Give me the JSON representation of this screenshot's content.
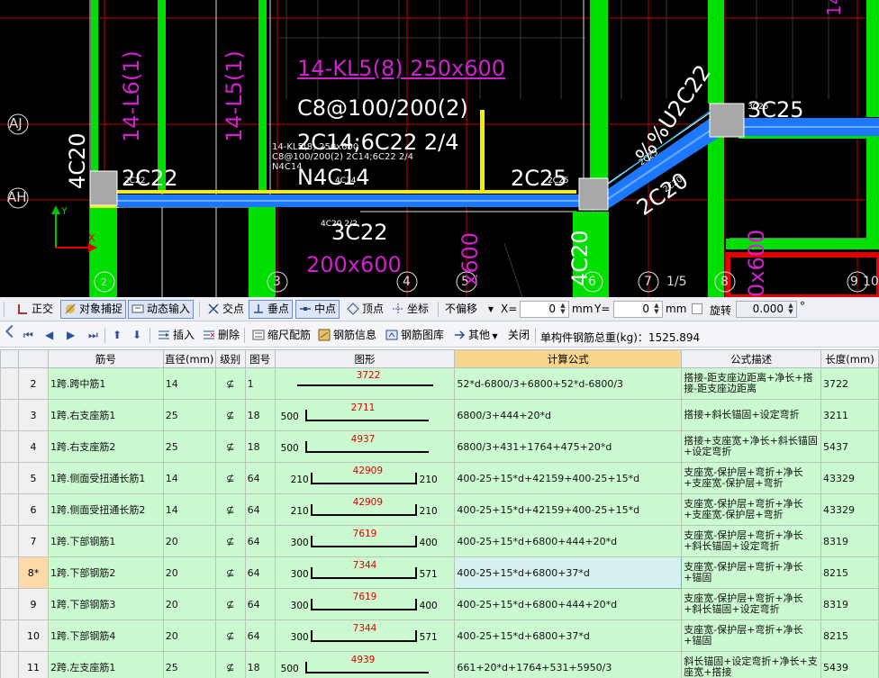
{
  "cad": {
    "axis_labels": {
      "aj": "AJ",
      "ah": "AH",
      "y": "Y",
      "x": "X"
    },
    "grid_numbers": [
      "2",
      "3",
      "4",
      "5",
      "6",
      "7",
      "1/5",
      "8",
      "9",
      "10"
    ],
    "beam_kl5": "14-KL5(8) 250x600",
    "beam_l6": "14-L6(1)",
    "beam_l5": "14-L5(1)",
    "stirrup": "C8@100/200(2)",
    "top_bars": "2C14;6C22 2/4",
    "side_bars": "N4C14",
    "bot_bars": "3C22",
    "section": "200x600",
    "small_lines": [
      "14-KL5(8) 250x600",
      "C8@100/200(2) 2C14;6C22 2/4",
      "N4C14"
    ],
    "col_4c20_left": "4C20",
    "col_4c20_mid": "4C20",
    "bar_2c22": "2C22",
    "bar_2c22_small": "2C22",
    "bar_2c25": "2C25",
    "bar_2c25_small": "2C25",
    "bar_3c25": "3C25",
    "bar_3c25_small": "3C25",
    "bar_2c20": "2C20",
    "bar_2c20_small": "2C20",
    "bar_4c14_small": "4C14",
    "bar_4c20_small": "4C20 2/2",
    "beam_diag": "%%U2C22",
    "beam_diag_small": "2C25",
    "purple_vert1": "x600",
    "purple_vert2": "0x600",
    "top_right_mark": "14"
  },
  "toolbar1": {
    "zhengjiao": "正交",
    "snap": "对象捕捉",
    "dyn_input": "动态输入",
    "intersect": "交点",
    "perp": "垂点",
    "mid": "中点",
    "vertex": "顶点",
    "coord": "坐标",
    "offset_mode": "不偏移",
    "x_label": "X=",
    "x_value": "0",
    "y_label": "Y=",
    "y_value": "0",
    "unit1": "mm",
    "unit2": "mm",
    "rotate_label": "旋转",
    "rotate_value": "0.000",
    "degree": "°"
  },
  "toolbar2": {
    "insert": "插入",
    "delete": "删除",
    "scale_rebar": "缩尺配筋",
    "rebar_info": "钢筋信息",
    "rebar_lib": "钢筋图库",
    "other": "其他",
    "close": "关闭",
    "total_weight": "单构件钢筋总重(kg)：1525.894"
  },
  "table": {
    "headers": [
      "筋号",
      "直径(mm)",
      "级别",
      "图号",
      "图形",
      "计算公式",
      "公式描述",
      "长度(mm)"
    ],
    "rows": [
      {
        "idx": "2",
        "name": "1跨.跨中筋1",
        "dia": "14",
        "grade": "⊈",
        "fig": "1",
        "shape": {
          "type": "line",
          "mid": "3722"
        },
        "formula": "52*d-6800/3+6800+52*d-6800/3",
        "desc": "搭接-距支座边距离+净长+搭接-距支座边距离",
        "len": "3722"
      },
      {
        "idx": "3",
        "name": "1跨.右支座筋1",
        "dia": "25",
        "grade": "⊈",
        "fig": "18",
        "shape": {
          "type": "hook-left",
          "left": "500",
          "mid": "2711"
        },
        "formula": "6800/3+444+20*d",
        "desc": "搭接+斜长锚固+设定弯折",
        "len": "3211"
      },
      {
        "idx": "4",
        "name": "1跨.右支座筋2",
        "dia": "25",
        "grade": "⊈",
        "fig": "18",
        "shape": {
          "type": "hook-left",
          "left": "500",
          "mid": "4937"
        },
        "formula": "6800/3+431+1764+475+20*d",
        "desc": "搭接+支座宽+净长+斜长锚固+设定弯折",
        "len": "5437"
      },
      {
        "idx": "5",
        "name": "1跨.侧面受扭通长筋1",
        "dia": "14",
        "grade": "⊈",
        "fig": "64",
        "shape": {
          "type": "u",
          "left": "210",
          "mid": "42909",
          "right": "210"
        },
        "formula": "400-25+15*d+42159+400-25+15*d",
        "desc": "支座宽-保护层+弯折+净长+支座宽-保护层+弯折",
        "len": "43329"
      },
      {
        "idx": "6",
        "name": "1跨.侧面受扭通长筋2",
        "dia": "14",
        "grade": "⊈",
        "fig": "64",
        "shape": {
          "type": "u",
          "left": "210",
          "mid": "42909",
          "right": "210"
        },
        "formula": "400-25+15*d+42159+400-25+15*d",
        "desc": "支座宽-保护层+弯折+净长+支座宽-保护层+弯折",
        "len": "43329"
      },
      {
        "idx": "7",
        "name": "1跨.下部钢筋1",
        "dia": "20",
        "grade": "⊈",
        "fig": "64",
        "shape": {
          "type": "u",
          "left": "300",
          "mid": "7619",
          "right": "400"
        },
        "formula": "400-25+15*d+6800+444+20*d",
        "desc": "支座宽-保护层+弯折+净长+斜长锚固+设定弯折",
        "len": "8319"
      },
      {
        "idx": "8*",
        "name": "1跨.下部钢筋2",
        "dia": "20",
        "grade": "⊈",
        "fig": "64",
        "shape": {
          "type": "u",
          "left": "300",
          "mid": "7344",
          "right": "571"
        },
        "formula": "400-25+15*d+6800+37*d",
        "desc": "支座宽-保护层+弯折+净长+锚固",
        "len": "8215",
        "current": true
      },
      {
        "idx": "9",
        "name": "1跨.下部钢筋3",
        "dia": "20",
        "grade": "⊈",
        "fig": "64",
        "shape": {
          "type": "u",
          "left": "300",
          "mid": "7619",
          "right": "400"
        },
        "formula": "400-25+15*d+6800+444+20*d",
        "desc": "支座宽-保护层+弯折+净长+斜长锚固+设定弯折",
        "len": "8319"
      },
      {
        "idx": "10",
        "name": "1跨.下部钢筋4",
        "dia": "20",
        "grade": "⊈",
        "fig": "64",
        "shape": {
          "type": "u",
          "left": "300",
          "mid": "7344",
          "right": "571"
        },
        "formula": "400-25+15*d+6800+37*d",
        "desc": "支座宽-保护层+弯折+净长+锚固",
        "len": "8215"
      },
      {
        "idx": "11",
        "name": "2跨.左支座筋1",
        "dia": "25",
        "grade": "⊈",
        "fig": "18",
        "shape": {
          "type": "hook-left",
          "left": "500",
          "mid": "4939"
        },
        "formula": "661+20*d+1764+531+5950/3",
        "desc": "斜长锚固+设定弯折+净长+支座宽+搭接",
        "len": "5439"
      }
    ]
  }
}
